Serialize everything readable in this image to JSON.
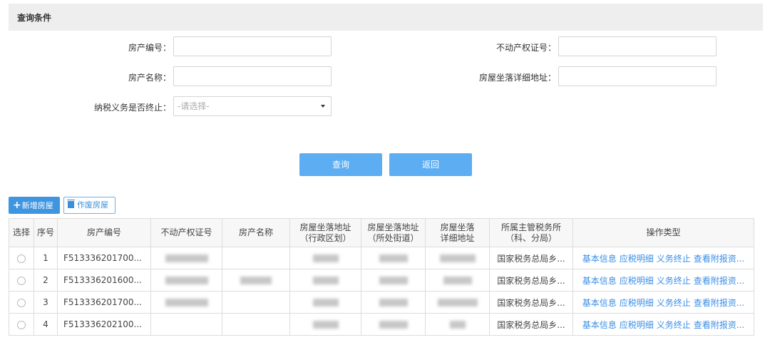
{
  "panel": {
    "title": "查询条件"
  },
  "form": {
    "property_no_label": "房产编号：",
    "cert_no_label": "不动产权证号：",
    "property_name_label": "房产名称：",
    "address_label": "房屋坐落详细地址：",
    "tax_end_label": "纳税义务是否终止：",
    "tax_end_placeholder": "-请选择-"
  },
  "buttons": {
    "query": "查询",
    "back": "返回",
    "add": "新增房屋",
    "void": "作废房屋"
  },
  "table": {
    "headers": {
      "select": "选择",
      "seq": "序号",
      "property_no": "房产编号",
      "cert_no": "不动产权证号",
      "name": "房产名称",
      "district_l1": "房屋坐落地址",
      "district_l2": "（行政区划）",
      "street_l1": "房屋坐落地址",
      "street_l2": "（所处街道）",
      "detail_l1": "房屋坐落",
      "detail_l2": "详细地址",
      "tax_office_l1": "所属主管税务所",
      "tax_office_l2": "（科、分局）",
      "ops": "操作类型"
    },
    "ops_labels": {
      "basic": "基本信息",
      "tax_detail": "应税明细",
      "terminate": "义务终止",
      "attachments": "查看附报资..."
    },
    "rows": [
      {
        "seq": "1",
        "property_no": "F513336201700...",
        "tax_office": "国家税务总局乡..."
      },
      {
        "seq": "2",
        "property_no": "F513336201600...",
        "tax_office": "国家税务总局乡..."
      },
      {
        "seq": "3",
        "property_no": "F513336201700...",
        "tax_office": "国家税务总局乡..."
      },
      {
        "seq": "4",
        "property_no": "F513336202100...",
        "tax_office": "国家税务总局乡..."
      }
    ]
  }
}
